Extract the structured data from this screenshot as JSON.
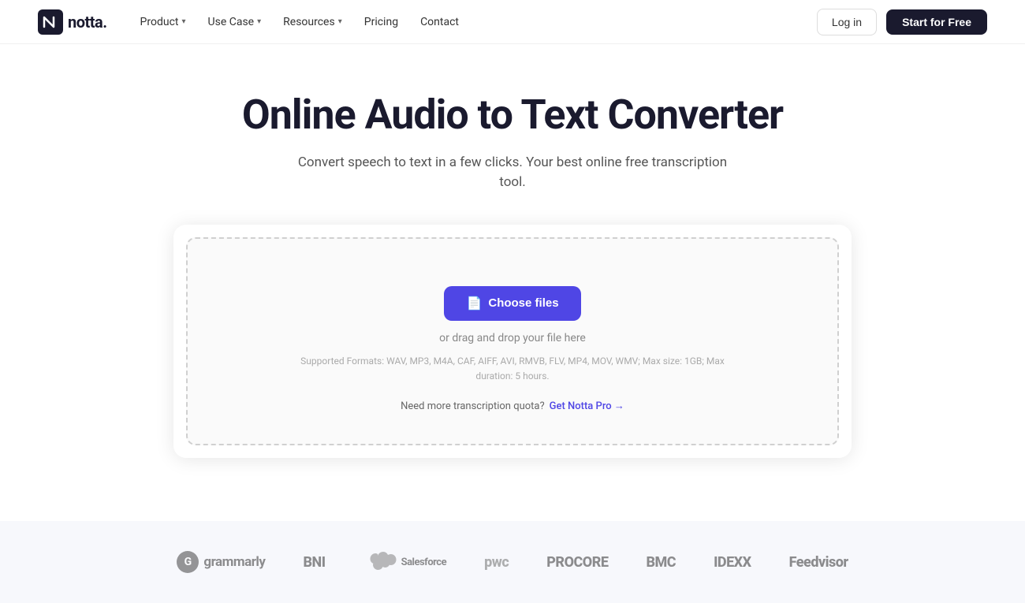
{
  "nav": {
    "logo_text": "notta.",
    "items": [
      {
        "label": "Product",
        "has_chevron": true
      },
      {
        "label": "Use Case",
        "has_chevron": true
      },
      {
        "label": "Resources",
        "has_chevron": true
      },
      {
        "label": "Pricing",
        "has_chevron": false
      },
      {
        "label": "Contact",
        "has_chevron": false
      }
    ],
    "login_label": "Log in",
    "start_label": "Start for Free"
  },
  "hero": {
    "title": "Online Audio to Text Converter",
    "subtitle": "Convert speech to text in a few clicks. Your best online free transcription tool."
  },
  "upload": {
    "choose_btn": "Choose files",
    "drag_text": "or drag and drop your file here",
    "formats_text": "Supported Formats: WAV, MP3, M4A, CAF, AIFF, AVI, RMVB, FLV, MP4, MOV, WMV; Max size: 1GB; Max duration: 5 hours.",
    "quota_text": "Need more transcription quota?",
    "pro_link": "Get Notta Pro →"
  },
  "brands": [
    {
      "name": "Grammarly",
      "type": "grammarly"
    },
    {
      "name": "BNI",
      "type": "bni"
    },
    {
      "name": "Salesforce",
      "type": "salesforce"
    },
    {
      "name": "PwC",
      "type": "pwc"
    },
    {
      "name": "Procore",
      "type": "procore"
    },
    {
      "name": "BMC",
      "type": "bmc"
    },
    {
      "name": "IDEXX",
      "type": "idexx"
    },
    {
      "name": "Feedvisor",
      "type": "feedvisor"
    }
  ],
  "colors": {
    "accent": "#4f46e5",
    "dark": "#1a1a2e",
    "text_muted": "#888"
  }
}
